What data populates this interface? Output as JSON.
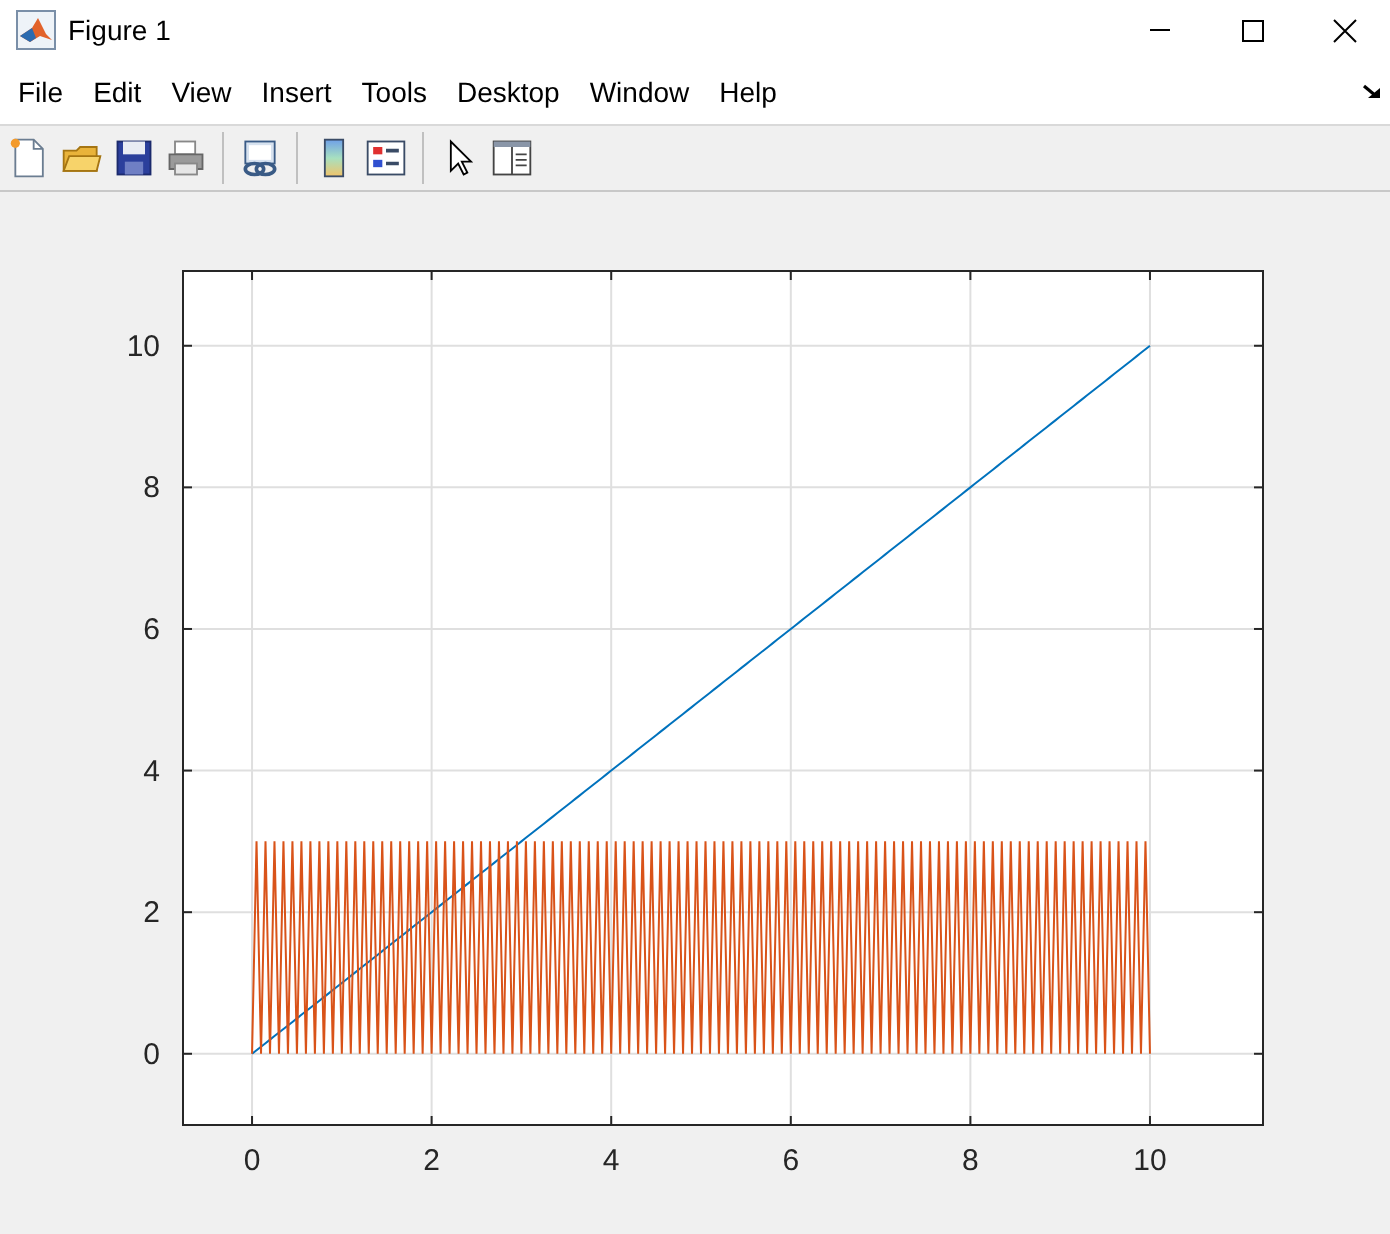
{
  "window": {
    "title": "Figure 1"
  },
  "menu": [
    {
      "label": "File"
    },
    {
      "label": "Edit"
    },
    {
      "label": "View"
    },
    {
      "label": "Insert"
    },
    {
      "label": "Tools"
    },
    {
      "label": "Desktop"
    },
    {
      "label": "Window"
    },
    {
      "label": "Help"
    }
  ],
  "toolbar": [
    {
      "kind": "new"
    },
    {
      "kind": "open"
    },
    {
      "kind": "save"
    },
    {
      "kind": "print"
    },
    {
      "kind": "sep"
    },
    {
      "kind": "link"
    },
    {
      "kind": "sep"
    },
    {
      "kind": "colorbar"
    },
    {
      "kind": "legend"
    },
    {
      "kind": "sep"
    },
    {
      "kind": "pointer"
    },
    {
      "kind": "property"
    }
  ],
  "figure": {
    "chart_data": {
      "type": "line",
      "grid": true,
      "xlim": [
        -0.78,
        11.27
      ],
      "ylim": [
        -1.02,
        11.07
      ],
      "xticks": [
        0,
        2,
        4,
        6,
        8,
        10
      ],
      "yticks": [
        0,
        2,
        4,
        6,
        8,
        10
      ],
      "x": [
        0,
        0.05,
        0.1,
        0.15,
        0.2,
        0.25,
        0.3,
        0.35,
        0.4,
        0.45,
        0.5,
        0.55,
        0.6,
        0.65,
        0.7,
        0.75,
        0.8,
        0.85,
        0.9,
        0.95,
        1,
        1.05,
        1.1,
        1.15,
        1.2,
        1.25,
        1.3,
        1.35,
        1.4,
        1.45,
        1.5,
        1.55,
        1.6,
        1.65,
        1.7,
        1.75,
        1.8,
        1.85,
        1.9,
        1.95,
        2,
        2.05,
        2.1,
        2.15,
        2.2,
        2.25,
        2.3,
        2.35,
        2.4,
        2.45,
        2.5,
        2.55,
        2.6,
        2.65,
        2.7,
        2.75,
        2.8,
        2.85,
        2.9,
        2.95,
        3,
        3.05,
        3.1,
        3.15,
        3.2,
        3.25,
        3.3,
        3.35,
        3.4,
        3.45,
        3.5,
        3.55,
        3.6,
        3.65,
        3.7,
        3.75,
        3.8,
        3.85,
        3.9,
        3.95,
        4,
        4.05,
        4.1,
        4.15,
        4.2,
        4.25,
        4.3,
        4.35,
        4.4,
        4.45,
        4.5,
        4.55,
        4.6,
        4.65,
        4.7,
        4.75,
        4.8,
        4.85,
        4.9,
        4.95,
        5,
        5.05,
        5.1,
        5.15,
        5.2,
        5.25,
        5.3,
        5.35,
        5.4,
        5.45,
        5.5,
        5.55,
        5.6,
        5.65,
        5.7,
        5.75,
        5.8,
        5.85,
        5.9,
        5.95,
        6,
        6.05,
        6.1,
        6.15,
        6.2,
        6.25,
        6.3,
        6.35,
        6.4,
        6.45,
        6.5,
        6.55,
        6.6,
        6.65,
        6.7,
        6.75,
        6.8,
        6.85,
        6.9,
        6.95,
        7,
        7.05,
        7.1,
        7.15,
        7.2,
        7.25,
        7.3,
        7.35,
        7.4,
        7.45,
        7.5,
        7.55,
        7.6,
        7.65,
        7.7,
        7.75,
        7.8,
        7.85,
        7.9,
        7.95,
        8,
        8.05,
        8.1,
        8.15,
        8.2,
        8.25,
        8.3,
        8.35,
        8.4,
        8.45,
        8.5,
        8.55,
        8.6,
        8.65,
        8.7,
        8.75,
        8.8,
        8.85,
        8.9,
        8.95,
        9,
        9.05,
        9.1,
        9.15,
        9.2,
        9.25,
        9.3,
        9.35,
        9.4,
        9.45,
        9.5,
        9.55,
        9.6,
        9.65,
        9.7,
        9.75,
        9.8,
        9.85,
        9.9,
        9.95,
        10
      ],
      "series": [
        {
          "color": "#0072bd",
          "values": [
            0,
            0.05,
            0.1,
            0.15,
            0.2,
            0.25,
            0.3,
            0.35,
            0.4,
            0.45,
            0.5,
            0.55,
            0.6,
            0.65,
            0.7,
            0.75,
            0.8,
            0.85,
            0.9,
            0.95,
            1,
            1.05,
            1.1,
            1.15,
            1.2,
            1.25,
            1.3,
            1.35,
            1.4,
            1.45,
            1.5,
            1.55,
            1.6,
            1.65,
            1.7,
            1.75,
            1.8,
            1.85,
            1.9,
            1.95,
            2,
            2.05,
            2.1,
            2.15,
            2.2,
            2.25,
            2.3,
            2.35,
            2.4,
            2.45,
            2.5,
            2.55,
            2.6,
            2.65,
            2.7,
            2.75,
            2.8,
            2.85,
            2.9,
            2.95,
            3,
            3.05,
            3.1,
            3.15,
            3.2,
            3.25,
            3.3,
            3.35,
            3.4,
            3.45,
            3.5,
            3.55,
            3.6,
            3.65,
            3.7,
            3.75,
            3.8,
            3.85,
            3.9,
            3.95,
            4,
            4.05,
            4.1,
            4.15,
            4.2,
            4.25,
            4.3,
            4.35,
            4.4,
            4.45,
            4.5,
            4.55,
            4.6,
            4.65,
            4.7,
            4.75,
            4.8,
            4.85,
            4.9,
            4.95,
            5,
            5.05,
            5.1,
            5.15,
            5.2,
            5.25,
            5.3,
            5.35,
            5.4,
            5.45,
            5.5,
            5.55,
            5.6,
            5.65,
            5.7,
            5.75,
            5.8,
            5.85,
            5.9,
            5.95,
            6,
            6.05,
            6.1,
            6.15,
            6.2,
            6.25,
            6.3,
            6.35,
            6.4,
            6.45,
            6.5,
            6.55,
            6.6,
            6.65,
            6.7,
            6.75,
            6.8,
            6.85,
            6.9,
            6.95,
            7,
            7.05,
            7.1,
            7.15,
            7.2,
            7.25,
            7.3,
            7.35,
            7.4,
            7.45,
            7.5,
            7.55,
            7.6,
            7.65,
            7.7,
            7.75,
            7.8,
            7.85,
            7.9,
            7.95,
            8,
            8.05,
            8.1,
            8.15,
            8.2,
            8.25,
            8.3,
            8.35,
            8.4,
            8.45,
            8.5,
            8.55,
            8.6,
            8.65,
            8.7,
            8.75,
            8.8,
            8.85,
            8.9,
            8.95,
            9,
            9.05,
            9.1,
            9.15,
            9.2,
            9.25,
            9.3,
            9.35,
            9.4,
            9.45,
            9.5,
            9.55,
            9.6,
            9.65,
            9.7,
            9.75,
            9.8,
            9.85,
            9.9,
            9.95,
            10
          ]
        },
        {
          "color": "#d95319",
          "values": [
            0,
            3,
            0,
            3,
            0,
            3,
            0,
            3,
            0,
            3,
            0,
            3,
            0,
            3,
            0,
            3,
            0,
            3,
            0,
            3,
            0,
            3,
            0,
            3,
            0,
            3,
            0,
            3,
            0,
            3,
            0,
            3,
            0,
            3,
            0,
            3,
            0,
            3,
            0,
            3,
            0,
            3,
            0,
            3,
            0,
            3,
            0,
            3,
            0,
            3,
            0,
            3,
            0,
            3,
            0,
            3,
            0,
            3,
            0,
            3,
            0,
            3,
            0,
            3,
            0,
            3,
            0,
            3,
            0,
            3,
            0,
            3,
            0,
            3,
            0,
            3,
            0,
            3,
            0,
            3,
            0,
            3,
            0,
            3,
            0,
            3,
            0,
            3,
            0,
            3,
            0,
            3,
            0,
            3,
            0,
            3,
            0,
            3,
            0,
            3,
            0,
            3,
            0,
            3,
            0,
            3,
            0,
            3,
            0,
            3,
            0,
            3,
            0,
            3,
            0,
            3,
            0,
            3,
            0,
            3,
            0,
            3,
            0,
            3,
            0,
            3,
            0,
            3,
            0,
            3,
            0,
            3,
            0,
            3,
            0,
            3,
            0,
            3,
            0,
            3,
            0,
            3,
            0,
            3,
            0,
            3,
            0,
            3,
            0,
            3,
            0,
            3,
            0,
            3,
            0,
            3,
            0,
            3,
            0,
            3,
            0,
            3,
            0,
            3,
            0,
            3,
            0,
            3,
            0,
            3,
            0,
            3,
            0,
            3,
            0,
            3,
            0,
            3,
            0,
            3,
            0,
            3,
            0,
            3,
            0,
            3,
            0,
            3,
            0,
            3,
            0,
            3,
            0,
            3,
            0,
            3,
            0,
            3,
            0,
            3,
            0
          ]
        }
      ]
    }
  }
}
